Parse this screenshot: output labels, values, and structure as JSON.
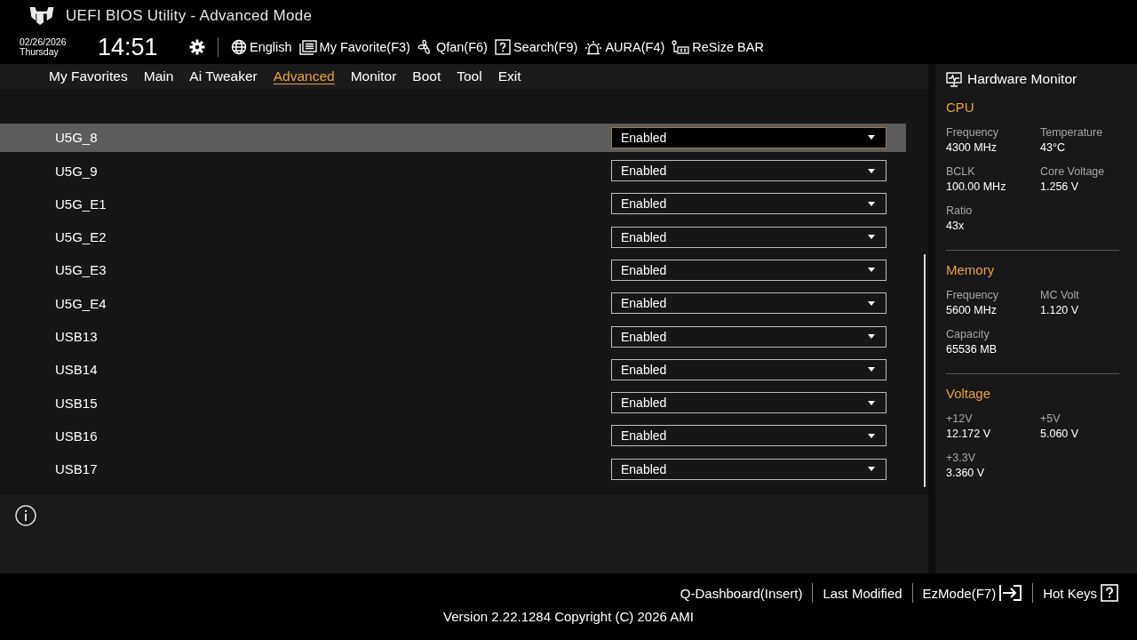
{
  "window": {
    "title": "UEFI BIOS Utility - Advanced Mode"
  },
  "header": {
    "date": "02/26/2026",
    "day": "Thursday",
    "time": "14:51",
    "tools": [
      {
        "kind": "language",
        "label": "English"
      },
      {
        "kind": "favorite",
        "label": "My Favorite(F3)"
      },
      {
        "kind": "fan",
        "label": "Qfan(F6)"
      },
      {
        "kind": "search",
        "label": "Search(F9)"
      },
      {
        "kind": "aura",
        "label": "AURA(F4)"
      },
      {
        "kind": "resize",
        "label": "ReSize BAR"
      }
    ]
  },
  "tabs": [
    {
      "label": "My Favorites",
      "selected": false
    },
    {
      "label": "Main",
      "selected": false
    },
    {
      "label": "Ai Tweaker",
      "selected": false
    },
    {
      "label": "Advanced",
      "selected": true
    },
    {
      "label": "Monitor",
      "selected": false
    },
    {
      "label": "Boot",
      "selected": false
    },
    {
      "label": "Tool",
      "selected": false
    },
    {
      "label": "Exit",
      "selected": false
    }
  ],
  "settings": [
    {
      "name": "U5G_8",
      "value": "Enabled",
      "selected": true
    },
    {
      "name": "U5G_9",
      "value": "Enabled",
      "selected": false
    },
    {
      "name": "U5G_E1",
      "value": "Enabled",
      "selected": false
    },
    {
      "name": "U5G_E2",
      "value": "Enabled",
      "selected": false
    },
    {
      "name": "U5G_E3",
      "value": "Enabled",
      "selected": false
    },
    {
      "name": "U5G_E4",
      "value": "Enabled",
      "selected": false
    },
    {
      "name": "USB13",
      "value": "Enabled",
      "selected": false
    },
    {
      "name": "USB14",
      "value": "Enabled",
      "selected": false
    },
    {
      "name": "USB15",
      "value": "Enabled",
      "selected": false
    },
    {
      "name": "USB16",
      "value": "Enabled",
      "selected": false
    },
    {
      "name": "USB17",
      "value": "Enabled",
      "selected": false
    }
  ],
  "hardware_monitor": {
    "title": "Hardware Monitor",
    "sections": [
      {
        "title": "CPU",
        "items": [
          {
            "label": "Frequency",
            "value": "4300 MHz"
          },
          {
            "label": "Temperature",
            "value": "43°C"
          },
          {
            "label": "BCLK",
            "value": "100.00 MHz"
          },
          {
            "label": "Core Voltage",
            "value": "1.256 V"
          },
          {
            "label": "Ratio",
            "value": "43x"
          }
        ]
      },
      {
        "title": "Memory",
        "items": [
          {
            "label": "Frequency",
            "value": "5600 MHz"
          },
          {
            "label": "MC Volt",
            "value": "1.120 V"
          },
          {
            "label": "Capacity",
            "value": "65536 MB"
          }
        ]
      },
      {
        "title": "Voltage",
        "items": [
          {
            "label": "+12V",
            "value": "12.172 V"
          },
          {
            "label": "+5V",
            "value": "5.060 V"
          },
          {
            "label": "+3.3V",
            "value": "3.360 V"
          }
        ]
      }
    ]
  },
  "footer": {
    "actions": [
      {
        "kind": "dashboard",
        "label": "Q-Dashboard(Insert)"
      },
      {
        "kind": "last",
        "label": "Last Modified"
      },
      {
        "kind": "ezmode",
        "label": "EzMode(F7)"
      },
      {
        "kind": "hotkeys",
        "label": "Hot Keys"
      }
    ],
    "version": "Version 2.22.1284 Copyright (C) 2026 AMI"
  }
}
